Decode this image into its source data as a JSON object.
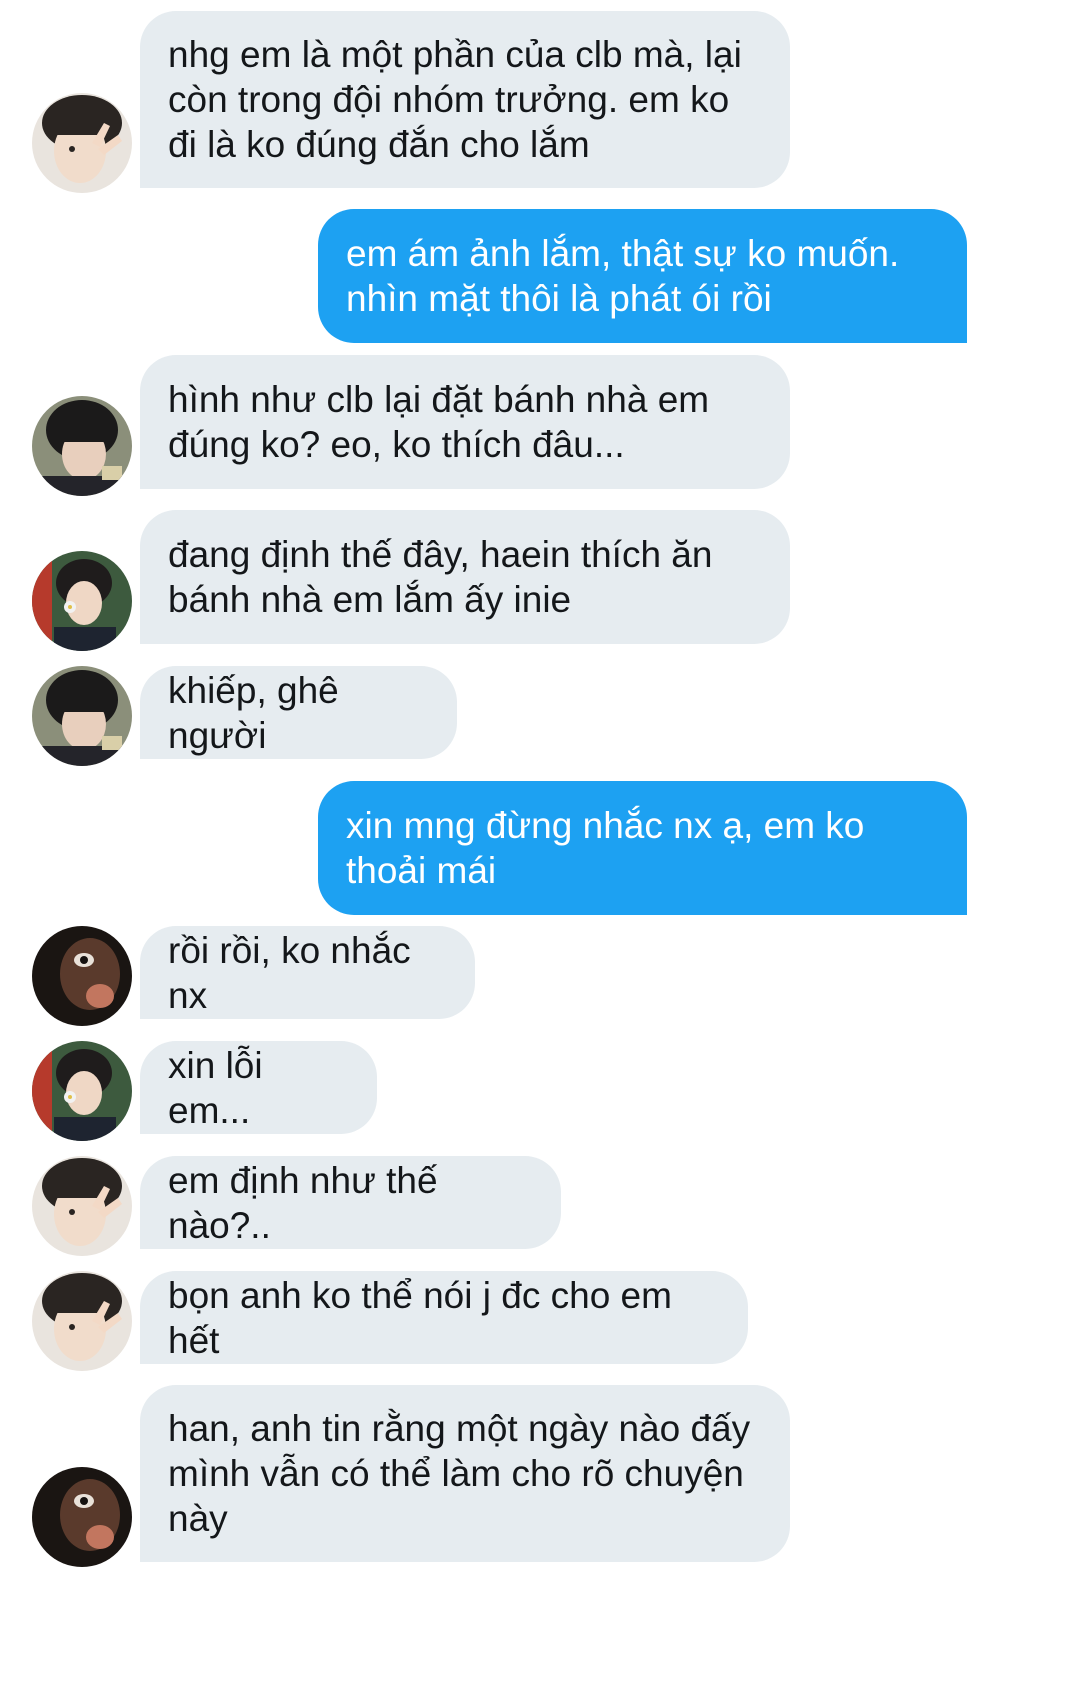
{
  "colors": {
    "incoming_bubble": "#e6ecf0",
    "outgoing_bubble": "#1da1f2",
    "incoming_text": "#14171a",
    "outgoing_text": "#ffffff",
    "background": "#ffffff"
  },
  "messages": [
    {
      "direction": "incoming",
      "avatar": "avatar-peace-sign-icon",
      "text": "nhg em là một phần của clb mà, lại còn trong đội nhóm trưởng. em ko đi là ko đúng đắn cho lắm"
    },
    {
      "direction": "outgoing",
      "text": "em ám ảnh lắm, thật sự ko muốn. nhìn mặt thôi là phát ói rồi"
    },
    {
      "direction": "incoming",
      "avatar": "avatar-dark-hair-icon",
      "text": "hình như clb lại đặt bánh nhà em đúng ko? eo, ko thích đâu..."
    },
    {
      "direction": "incoming",
      "avatar": "avatar-flower-icon",
      "text": "đang định thế đây, haein thích ăn bánh nhà em lắm ấy inie"
    },
    {
      "direction": "incoming",
      "avatar": "avatar-dark-hair-icon",
      "text": "khiếp, ghê người"
    },
    {
      "direction": "outgoing",
      "text": "xin mng đừng nhắc nx ạ, em ko thoải mái"
    },
    {
      "direction": "incoming",
      "avatar": "avatar-closeup-eye-icon",
      "text": "rồi rồi, ko nhắc nx"
    },
    {
      "direction": "incoming",
      "avatar": "avatar-flower-icon",
      "text": "xin lỗi em..."
    },
    {
      "direction": "incoming",
      "avatar": "avatar-peace-sign-icon",
      "text": "em định như thế nào?.."
    },
    {
      "direction": "incoming",
      "avatar": "avatar-peace-sign-icon",
      "text": "bọn anh ko thể nói j đc cho em hết"
    },
    {
      "direction": "incoming",
      "avatar": "avatar-closeup-eye-icon",
      "text": "han, anh tin rằng một ngày nào đấy mình vẫn có thể làm cho rõ chuyện này"
    }
  ]
}
